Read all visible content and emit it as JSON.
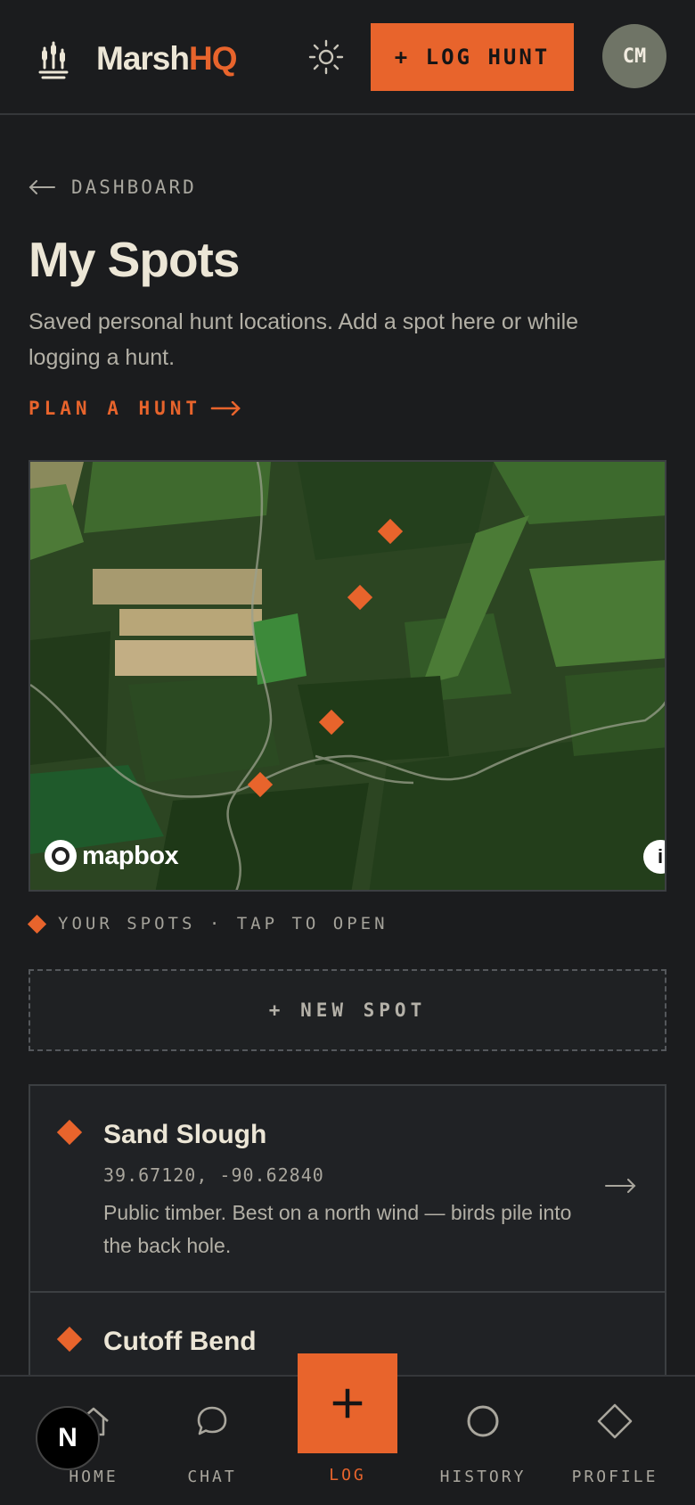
{
  "header": {
    "brand_part1": "Marsh",
    "brand_part2": "HQ",
    "log_button": "+ LOG HUNT",
    "avatar_initials": "CM"
  },
  "back_link": "DASHBOARD",
  "page": {
    "title": "My Spots",
    "description": "Saved personal hunt locations. Add a spot here or while logging a hunt.",
    "plan_link": "PLAN A HUNT"
  },
  "map": {
    "attribution": "mapbox",
    "info_label": "i",
    "marker_count": 4
  },
  "legend": "YOUR SPOTS · TAP TO OPEN",
  "new_spot_button": "+ NEW SPOT",
  "spots": [
    {
      "name": "Sand Slough",
      "coords": "39.67120, -90.62840",
      "note": "Public timber. Best on a north wind — birds pile into the back hole."
    },
    {
      "name": "Cutoff Bend"
    }
  ],
  "nav": {
    "home": "HOME",
    "chat": "CHAT",
    "log": "LOG",
    "history": "HISTORY",
    "profile": "PROFILE"
  },
  "dev_badge": "N",
  "colors": {
    "accent": "#e8642c",
    "background": "#1b1c1e",
    "text": "#ece6d6"
  }
}
